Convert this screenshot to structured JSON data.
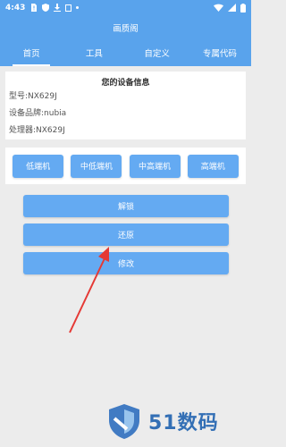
{
  "status_bar": {
    "time": "4:43"
  },
  "app_bar": {
    "title": "画质阁"
  },
  "tabs": [
    {
      "label": "首页",
      "active": true
    },
    {
      "label": "工具",
      "active": false
    },
    {
      "label": "自定义",
      "active": false
    },
    {
      "label": "专属代码",
      "active": false
    }
  ],
  "device_info": {
    "title": "您的设备信息",
    "model": "型号:NX629J",
    "brand": "设备品牌:nubia",
    "processor": "处理器:NX629J"
  },
  "levels": {
    "low": "低端机",
    "mid_low": "中低端机",
    "mid_high": "中高端机",
    "high": "高端机"
  },
  "actions": {
    "unlock": "解锁",
    "restore": "还原",
    "modify": "修改"
  },
  "watermark": {
    "text": "51数码"
  },
  "colors": {
    "primary": "#59a3ec",
    "button": "#64aaf2",
    "annotation": "#e53935"
  }
}
